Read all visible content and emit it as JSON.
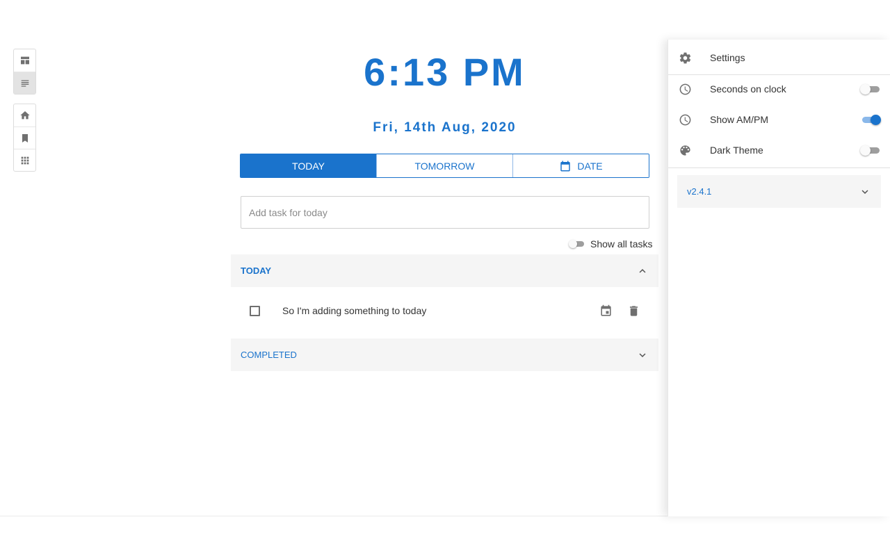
{
  "rail": {
    "group1": [
      {
        "icon": "dashboard-view-icon",
        "active": false
      },
      {
        "icon": "list-view-icon",
        "active": true
      }
    ],
    "group2": [
      {
        "icon": "home-icon"
      },
      {
        "icon": "bookmark-icon"
      },
      {
        "icon": "apps-grid-icon"
      }
    ]
  },
  "clock": {
    "time": "6:13 PM",
    "date": "Fri, 14th Aug, 2020"
  },
  "tabs": {
    "today": "TODAY",
    "tomorrow": "TOMORROW",
    "date": "DATE",
    "active": "today"
  },
  "task_input": {
    "placeholder": "Add task for today",
    "value": ""
  },
  "show_all": {
    "label": "Show all tasks",
    "enabled": false
  },
  "sections": {
    "today": {
      "title": "TODAY",
      "expanded": true
    },
    "completed": {
      "title": "COMPLETED",
      "expanded": false
    }
  },
  "tasks": [
    {
      "text": "So I'm adding something to today",
      "done": false
    }
  ],
  "settings": {
    "title": "Settings",
    "options": [
      {
        "label": "Seconds on clock",
        "icon": "clock-icon",
        "enabled": false
      },
      {
        "label": "Show AM/PM",
        "icon": "clock-icon",
        "enabled": true
      },
      {
        "label": "Dark Theme",
        "icon": "palette-icon",
        "enabled": false
      }
    ],
    "version": "v2.4.1"
  },
  "colors": {
    "accent": "#1a73cc",
    "section_bg": "#f5f5f5"
  }
}
